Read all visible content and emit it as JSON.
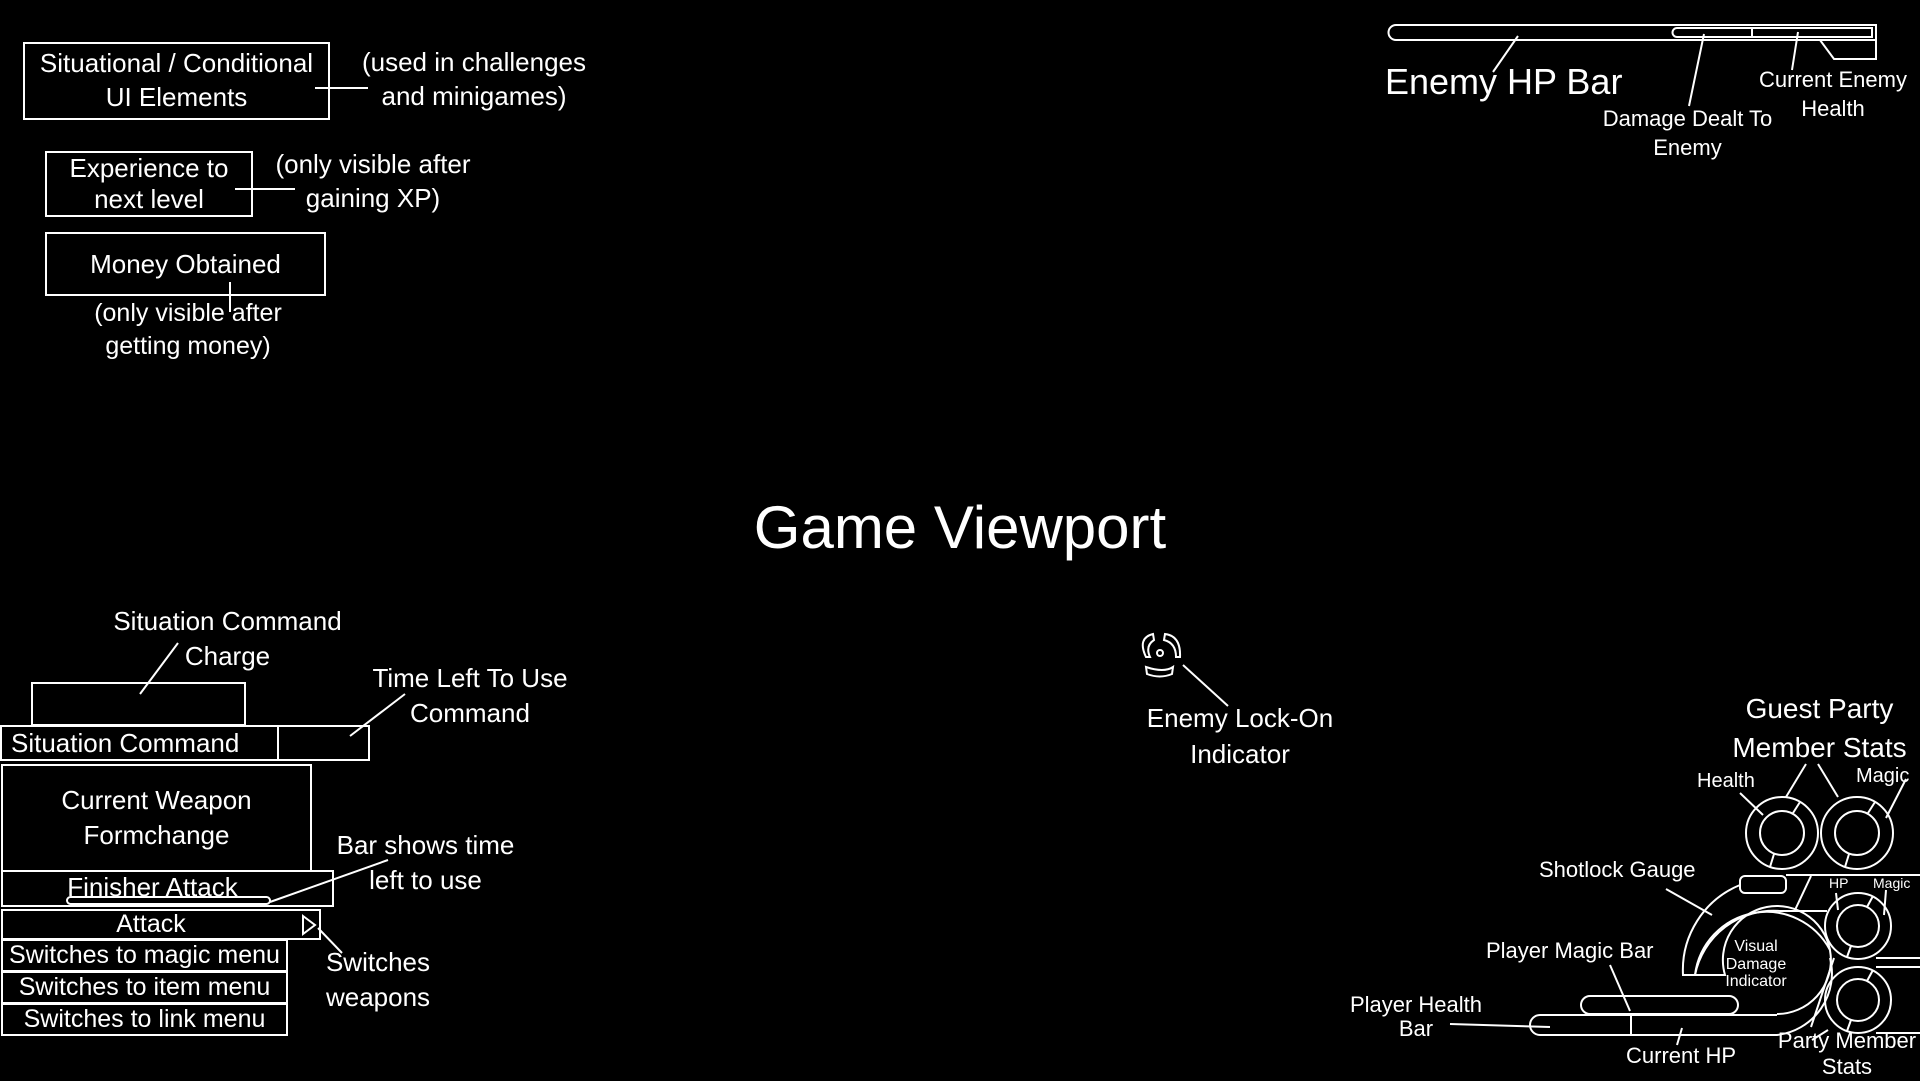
{
  "colors": {
    "background": "#000000",
    "foreground": "#ffffff"
  },
  "viewport": {
    "title": "Game Viewport"
  },
  "top_left": {
    "situational_box": "Situational / Conditional UI Elements",
    "situational_note": "(used in challenges and minigames)",
    "experience_box": "Experience to next level",
    "experience_note": "(only visible after gaining XP)",
    "money_box": "Money Obtained",
    "money_note": "(only visible after getting money)"
  },
  "enemy_bar": {
    "title": "Enemy HP Bar",
    "damage_label": "Damage Dealt To Enemy",
    "current_label": "Current Enemy Health"
  },
  "command_menu": {
    "charge_label": "Situation Command Charge",
    "time_label": "Time Left To Use Command",
    "situation_command": "Situation Command",
    "weapon_formchange": "Current Weapon Formchange",
    "finisher_attack": "Finisher Attack",
    "bar_note": "Bar shows time left to use",
    "items": [
      "Attack",
      "Switches to magic menu",
      "Switches to item menu",
      "Switches to link menu"
    ],
    "switch_weapons_note": "Switches weapons"
  },
  "lock_on": {
    "label": "Enemy Lock-On Indicator",
    "icon": "lock-on-reticle-icon"
  },
  "hud": {
    "guest_title": "Guest Party Member Stats",
    "guest_health": "Health",
    "guest_magic": "Magic",
    "party_hp": "HP",
    "party_magic": "Magic",
    "shotlock": "Shotlock Gauge",
    "visual_damage": "Visual Damage Indicator",
    "player_magic": "Player Magic Bar",
    "player_health": "Player Health Bar",
    "current_hp": "Current HP",
    "party_stats": "Party Member Stats"
  }
}
